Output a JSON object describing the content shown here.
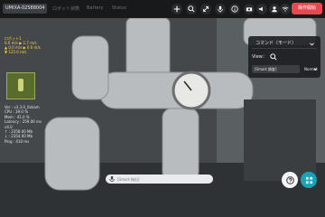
{
  "topbar": {
    "device_id": "UMIXA-02588004",
    "muted_1": "ロボット状態",
    "muted_2": "Battery",
    "muted_3": "Status",
    "operate_label": "操作開始",
    "icons": [
      "plus-icon",
      "search-icon",
      "arrows-icon",
      "mic-icon",
      "info-icon",
      "camera-icon",
      "speaker-icon",
      "user-icon",
      "wifi-icon",
      "grid-icon"
    ]
  },
  "telemetry": [
    "ロボット1",
    "0.0 m/s ▶ 1.7 m/s",
    "▲ 0.0 m/s ▶ 0.0 m/s",
    "▼ 125.0 m/s"
  ],
  "sys_info": [
    "Ver : v3.3.0_itokam",
    "CPU : 39.0 %",
    "Mem : 41.0 %",
    "Latency : 259.00 ms",
    "v4.0",
    "↑ : 2358.00 Mb",
    "↓ : 2354.00 Mb",
    "Ping : 410 ms"
  ],
  "panel": {
    "title": "コマンド（モード）",
    "view_label": "View：",
    "view_select": "[Smart 調査]",
    "view_value": "Normal"
  },
  "search": {
    "placeholder": "[Smart 検出]"
  },
  "colors": {
    "accent": "#e8474f",
    "fab": "#1aa3b8",
    "telemetry": "#ffd54a"
  }
}
